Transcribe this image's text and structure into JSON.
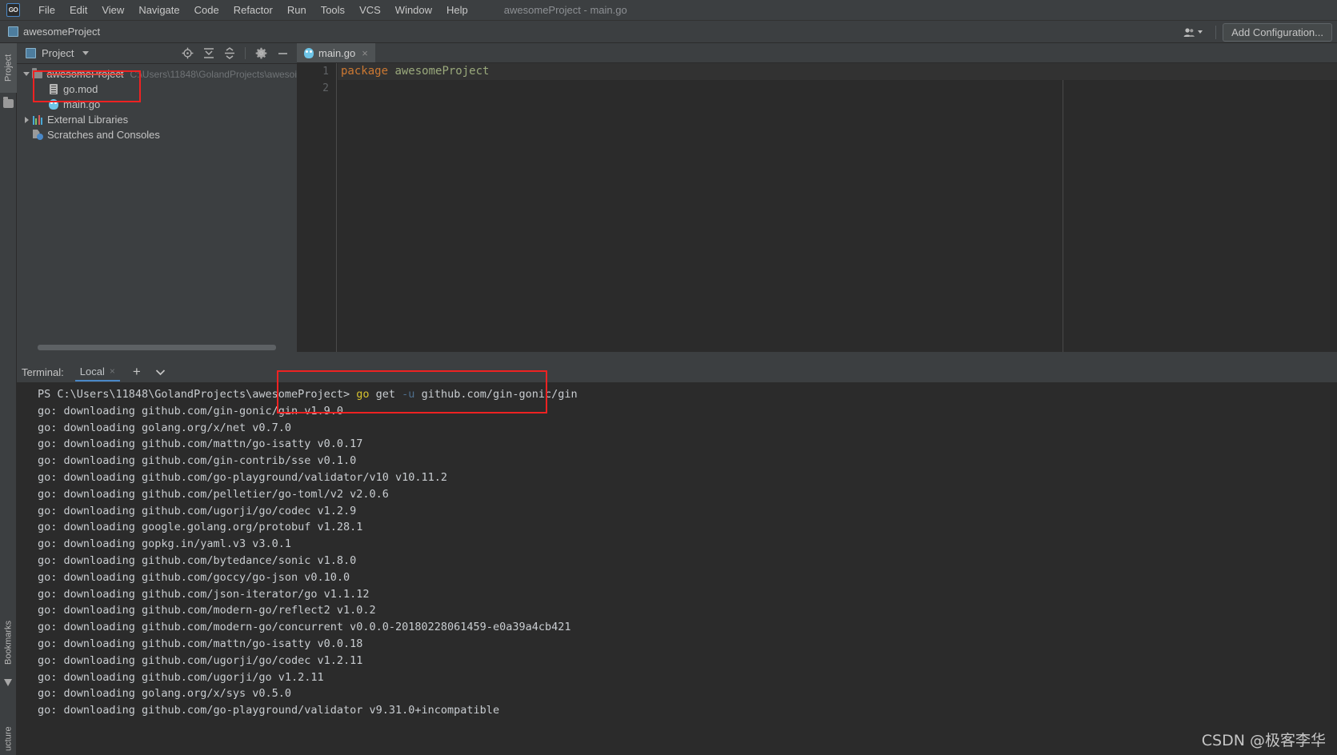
{
  "window": {
    "title": "awesomeProject - main.go",
    "app_logo_text": "GO"
  },
  "menubar": {
    "items": [
      {
        "label": "File"
      },
      {
        "label": "Edit"
      },
      {
        "label": "View"
      },
      {
        "label": "Navigate"
      },
      {
        "label": "Code"
      },
      {
        "label": "Refactor"
      },
      {
        "label": "Run"
      },
      {
        "label": "Tools"
      },
      {
        "label": "VCS"
      },
      {
        "label": "Window"
      },
      {
        "label": "Help"
      }
    ]
  },
  "navbar": {
    "breadcrumb": "awesomeProject",
    "add_configuration": "Add Configuration..."
  },
  "left_tool_strip": {
    "project_label": "Project",
    "bookmarks_label": "Bookmarks",
    "structure_label": "ucture"
  },
  "project_panel": {
    "title": "Project",
    "tools": [
      "locate-icon",
      "expand-all-icon",
      "collapse-all-icon",
      "settings-gear-icon",
      "hide-icon"
    ],
    "tree": [
      {
        "label": "awesomeProject",
        "detail": "C:\\Users\\11848\\GolandProjects\\awesoi",
        "icon": "folder-icon",
        "expanded": true,
        "indent": 0
      },
      {
        "label": "go.mod",
        "detail": "",
        "icon": "go-mod-file-icon",
        "indent": 1
      },
      {
        "label": "main.go",
        "detail": "",
        "icon": "go-file-icon",
        "indent": 1
      },
      {
        "label": "External Libraries",
        "detail": "",
        "icon": "libraries-icon",
        "expanded": false,
        "indent": 0
      },
      {
        "label": "Scratches and Consoles",
        "detail": "",
        "icon": "scratches-icon",
        "indent": 0
      }
    ]
  },
  "editor": {
    "tab": {
      "label": "main.go",
      "icon": "go-file-icon",
      "close": "×"
    },
    "line_numbers": [
      "1",
      "2"
    ],
    "code": {
      "line1_keyword": "package",
      "line1_name": "awesomeProject",
      "line2": ""
    }
  },
  "terminal": {
    "label": "Terminal:",
    "tabs": [
      {
        "label": "Local",
        "active": true,
        "close": "×"
      }
    ],
    "new_tab": "+",
    "dropdown": "⌄",
    "prompt": "PS C:\\Users\\11848\\GolandProjects\\awesomeProject> ",
    "command_go": "go",
    "command_rest_pre": " get ",
    "command_flag": "-u",
    "command_rest_post": " github.com/gin-gonic/gin",
    "output": [
      "go: downloading github.com/gin-gonic/gin v1.9.0",
      "go: downloading golang.org/x/net v0.7.0",
      "go: downloading github.com/mattn/go-isatty v0.0.17",
      "go: downloading github.com/gin-contrib/sse v0.1.0",
      "go: downloading github.com/go-playground/validator/v10 v10.11.2",
      "go: downloading github.com/pelletier/go-toml/v2 v2.0.6",
      "go: downloading github.com/ugorji/go/codec v1.2.9",
      "go: downloading google.golang.org/protobuf v1.28.1",
      "go: downloading gopkg.in/yaml.v3 v3.0.1",
      "go: downloading github.com/bytedance/sonic v1.8.0",
      "go: downloading github.com/goccy/go-json v0.10.0",
      "go: downloading github.com/json-iterator/go v1.1.12",
      "go: downloading github.com/modern-go/reflect2 v1.0.2",
      "go: downloading github.com/modern-go/concurrent v0.0.0-20180228061459-e0a39a4cb421",
      "go: downloading github.com/mattn/go-isatty v0.0.18",
      "go: downloading github.com/ugorji/go/codec v1.2.11",
      "go: downloading github.com/ugorji/go v1.2.11",
      "go: downloading golang.org/x/sys v0.5.0",
      "go: downloading github.com/go-playground/validator v9.31.0+incompatible"
    ]
  },
  "annotations": {
    "box_gomod": "highlight-go-mod",
    "box_command": "highlight-go-get-command",
    "color": "#ee2222"
  },
  "watermark": "CSDN @极客李华",
  "colors": {
    "bg_panel": "#3c3f41",
    "bg_editor": "#2b2b2b",
    "accent": "#4a88c7",
    "keyword": "#cc7832",
    "package_name": "#9aa97c",
    "terminal_go": "#d6c22e",
    "annotation_red": "#ee2222"
  }
}
